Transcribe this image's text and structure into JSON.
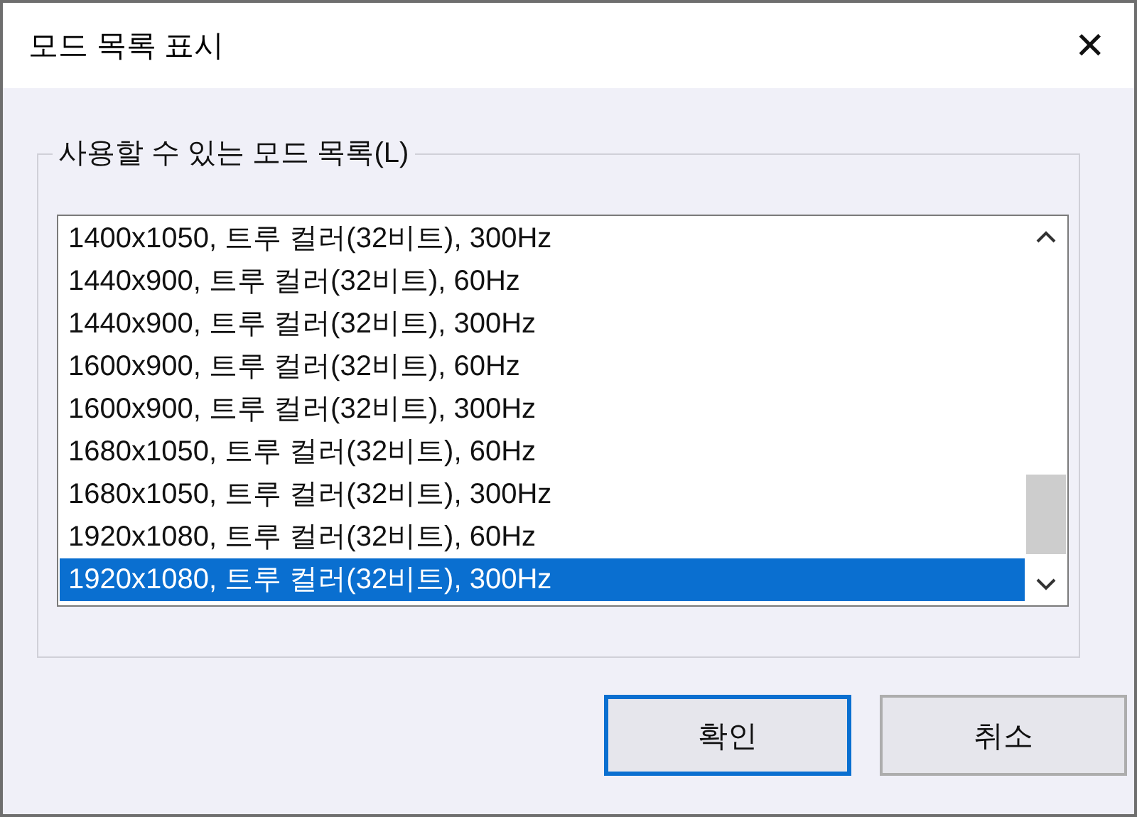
{
  "window": {
    "title": "모드 목록 표시",
    "close": "✕"
  },
  "group": {
    "label": "사용할 수 있는 모드 목록(L)"
  },
  "list": {
    "items": [
      {
        "label": "1400x1050, 트루 컬러(32비트), 300Hz",
        "selected": false
      },
      {
        "label": "1440x900, 트루 컬러(32비트), 60Hz",
        "selected": false
      },
      {
        "label": "1440x900, 트루 컬러(32비트), 300Hz",
        "selected": false
      },
      {
        "label": "1600x900, 트루 컬러(32비트), 60Hz",
        "selected": false
      },
      {
        "label": "1600x900, 트루 컬러(32비트), 300Hz",
        "selected": false
      },
      {
        "label": "1680x1050, 트루 컬러(32비트), 60Hz",
        "selected": false
      },
      {
        "label": "1680x1050, 트루 컬러(32비트), 300Hz",
        "selected": false
      },
      {
        "label": "1920x1080, 트루 컬러(32비트), 60Hz",
        "selected": false
      },
      {
        "label": "1920x1080, 트루 컬러(32비트), 300Hz",
        "selected": true
      }
    ]
  },
  "buttons": [
    {
      "label": "확인",
      "default": true
    },
    {
      "label": "취소",
      "default": false
    }
  ]
}
